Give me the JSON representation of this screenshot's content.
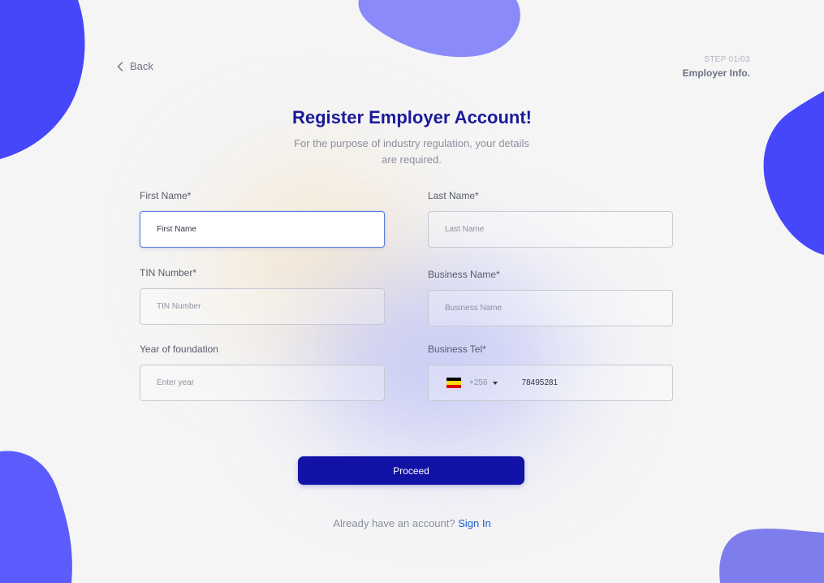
{
  "nav": {
    "back_label": "Back",
    "step_count": "STEP 01/03",
    "step_name": "Employer Info."
  },
  "header": {
    "title": "Register Employer Account!",
    "subtitle": "For the purpose of industry regulation, your details are required."
  },
  "form": {
    "first_name": {
      "label": "First Name*",
      "placeholder": "First Name"
    },
    "last_name": {
      "label": "Last Name*",
      "placeholder": "Last Name"
    },
    "tin_number": {
      "label": "TIN Number*",
      "placeholder": "TIN Number"
    },
    "business_name": {
      "label": "Business Name*",
      "placeholder": "Business Name"
    },
    "year_of_foundation": {
      "label": "Year of foundation",
      "placeholder": "Enter year"
    },
    "business_tel": {
      "label": "Business Tel*",
      "country_code": "+256",
      "number": "78495281",
      "flag_colors": [
        "#000000",
        "#fcdc04",
        "#d90000"
      ]
    },
    "proceed_label": "Proceed"
  },
  "footer": {
    "prompt": "Already have an account?",
    "signin_label": "Sign In"
  },
  "colors": {
    "brand": "#1212a6",
    "heading": "#1a1a9b",
    "link": "#1e5bc6",
    "blob_primary": "#4a4afc",
    "blob_secondary": "#8b8bfb"
  }
}
